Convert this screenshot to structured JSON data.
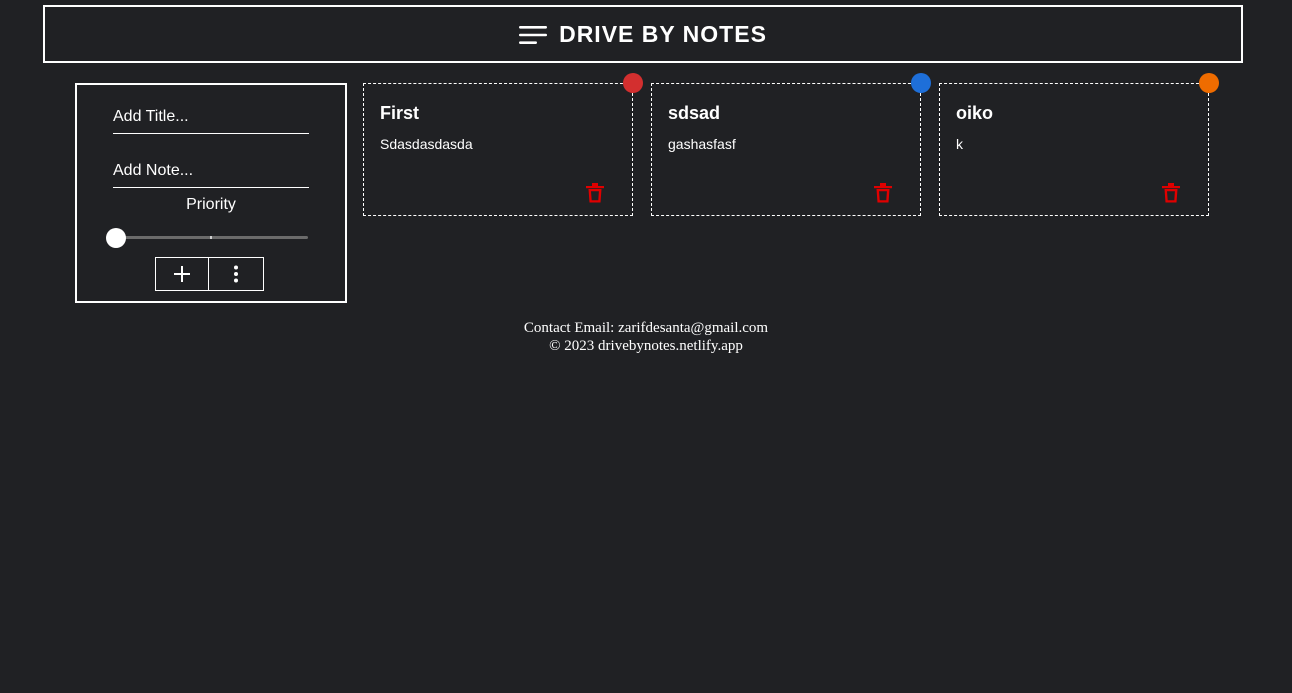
{
  "header": {
    "title": "DRIVE BY NOTES",
    "icon": "menu-icon"
  },
  "form": {
    "title_placeholder": "Add Title...",
    "note_placeholder": "Add Note...",
    "priority_label": "Priority",
    "priority_value_fraction": 0.0,
    "add_icon": "plus-icon",
    "more_icon": "more-vertical-icon"
  },
  "notes": [
    {
      "title": "First",
      "body": "Sdasdasdasda",
      "color": "#d32f2f",
      "delete_icon": "trash-icon"
    },
    {
      "title": "sdsad",
      "body": "gashasfasf",
      "color": "#1e6fd9",
      "delete_icon": "trash-icon"
    },
    {
      "title": "oiko",
      "body": "k",
      "color": "#ef6c00",
      "delete_icon": "trash-icon"
    }
  ],
  "footer": {
    "contact": "Contact Email: zarifdesanta@gmail.com",
    "copyright": "© 2023 drivebynotes.netlify.app"
  },
  "colors": {
    "background": "#202124",
    "text": "#ffffff",
    "delete": "#e00000"
  }
}
